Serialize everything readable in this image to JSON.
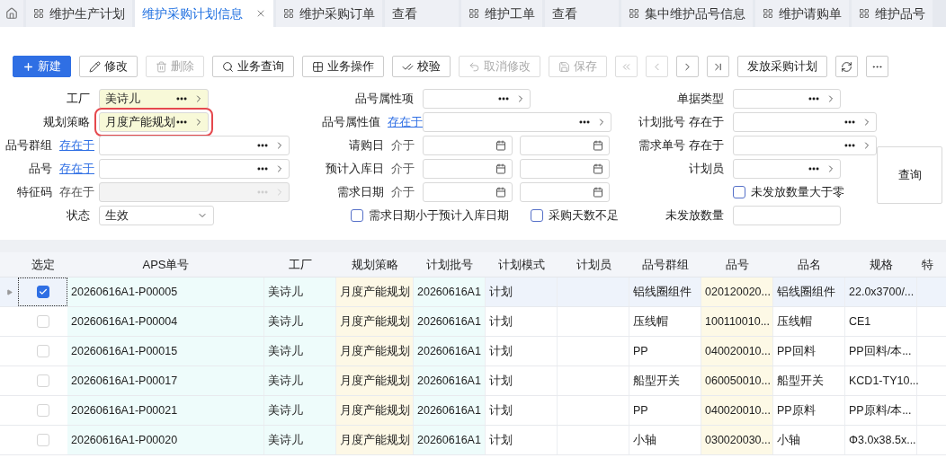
{
  "tabs": [
    {
      "label": "维护生产计划",
      "kind": "page",
      "selected": false
    },
    {
      "label": "维护采购计划信息",
      "kind": "closable",
      "selected": true
    },
    {
      "label": "维护采购订单",
      "kind": "page",
      "selected": false
    },
    {
      "label": "查看",
      "kind": "view",
      "selected": false
    },
    {
      "label": "维护工单",
      "kind": "page",
      "selected": false
    },
    {
      "label": "查看",
      "kind": "view",
      "selected": false
    },
    {
      "label": "集中维护品号信息",
      "kind": "page",
      "selected": false
    },
    {
      "label": "维护请购单",
      "kind": "page",
      "selected": false
    },
    {
      "label": "维护品号",
      "kind": "page",
      "selected": false
    }
  ],
  "toolbar": [
    {
      "kind": "primary",
      "label": "新建",
      "disabled": false
    },
    {
      "kind": "normal",
      "label": "修改",
      "disabled": false
    },
    {
      "kind": "normal",
      "label": "删除",
      "disabled": true
    },
    {
      "kind": "normal",
      "label": "业务查询",
      "disabled": false
    },
    {
      "kind": "normal",
      "label": "业务操作",
      "disabled": false
    },
    {
      "kind": "normal",
      "label": "校验",
      "disabled": false
    },
    {
      "kind": "normal",
      "label": "取消修改",
      "disabled": true
    },
    {
      "kind": "normal",
      "label": "保存",
      "disabled": true
    },
    {
      "kind": "nav",
      "disabled": true
    },
    {
      "kind": "nav",
      "disabled": true
    },
    {
      "kind": "nav",
      "disabled": false
    },
    {
      "kind": "nav",
      "disabled": false
    },
    {
      "kind": "normal",
      "label": "发放采购计划",
      "disabled": false
    },
    {
      "kind": "icon",
      "disabled": false
    },
    {
      "kind": "icon",
      "disabled": false
    }
  ],
  "filters": {
    "left": [
      {
        "kind": "lookup",
        "label": "工厂",
        "value": "美诗儿",
        "tinted": true,
        "highlighted": false,
        "disabled": false
      },
      {
        "kind": "lookup",
        "label": "规划策略",
        "value": "月度产能规划",
        "tinted": true,
        "highlighted": true,
        "disabled": false
      },
      {
        "kind": "lookup_wide",
        "label": "品号群组",
        "operator": "存在于",
        "operator_link": true,
        "tinted": false,
        "highlighted": false,
        "disabled": false
      },
      {
        "kind": "lookup_wide",
        "label": "品号",
        "operator": "存在于",
        "operator_link": true,
        "tinted": false,
        "highlighted": false,
        "disabled": false
      },
      {
        "kind": "lookup_wide",
        "label": "特征码",
        "operator": "存在于",
        "operator_link": false,
        "tinted": false,
        "highlighted": false,
        "disabled": true
      },
      {
        "kind": "select",
        "label": "状态",
        "value": "生效"
      }
    ],
    "middle": [
      {
        "kind": "lookup",
        "label": "品号属性项",
        "tinted": false,
        "highlighted": false,
        "disabled": false
      },
      {
        "kind": "lookup_wide",
        "label": "品号属性值",
        "operator": "存在于",
        "operator_link": true,
        "tinted": false,
        "highlighted": false,
        "disabled": false
      },
      {
        "kind": "date_range",
        "label": "请购日",
        "operator": "介于"
      },
      {
        "kind": "date_range",
        "label": "预计入库日",
        "operator": "介于"
      },
      {
        "kind": "date_range",
        "label": "需求日期",
        "operator": "介于"
      },
      {
        "kind": "checkboxes",
        "items": [
          {
            "label": "需求日期小于预计入库日期",
            "checked": false
          },
          {
            "label": "采购天数不足",
            "checked": false
          }
        ]
      }
    ],
    "right": [
      {
        "kind": "lookup",
        "label": "单据类型",
        "tinted": false,
        "highlighted": false,
        "disabled": false
      },
      {
        "kind": "lookup_wide",
        "label": "计划批号 存在于",
        "tinted": false,
        "highlighted": false,
        "disabled": false
      },
      {
        "kind": "lookup_wide",
        "label": "需求单号 存在于",
        "tinted": false,
        "highlighted": false,
        "disabled": false
      },
      {
        "kind": "lookup",
        "label": "计划员",
        "tinted": false,
        "highlighted": false,
        "disabled": false
      },
      {
        "kind": "checkbox",
        "label": "未发放数量大于零",
        "checked": false
      },
      {
        "kind": "text",
        "label": "未发放数量"
      }
    ],
    "query_button": "查询"
  },
  "table": {
    "columns": [
      {
        "label": "选定"
      },
      {
        "label": "APS单号",
        "color": "#eefcfb"
      },
      {
        "label": "工厂",
        "color": "#eefcfb"
      },
      {
        "label": "规划策略",
        "color": "#fdf8e6"
      },
      {
        "label": "计划批号",
        "color": "#eefcfb"
      },
      {
        "label": "计划模式"
      },
      {
        "label": "计划员"
      },
      {
        "label": "品号群组"
      },
      {
        "label": "品号",
        "color": "#fdf9e6"
      },
      {
        "label": "品名"
      },
      {
        "label": "规格"
      },
      {
        "label": "特"
      }
    ],
    "rows": [
      {
        "current": true,
        "checked": true,
        "cells": [
          "",
          "20260616A1-P00005",
          "美诗儿",
          "月度产能规划",
          "20260616A1",
          "计划",
          "",
          "铝线圈组件",
          "020120020...",
          "铝线圈组件",
          "22.0x3700/...",
          ""
        ]
      },
      {
        "current": false,
        "checked": false,
        "cells": [
          "",
          "20260616A1-P00004",
          "美诗儿",
          "月度产能规划",
          "20260616A1",
          "计划",
          "",
          "压线帽",
          "100110010...",
          "压线帽",
          "CE1",
          ""
        ]
      },
      {
        "current": false,
        "checked": false,
        "cells": [
          "",
          "20260616A1-P00015",
          "美诗儿",
          "月度产能规划",
          "20260616A1",
          "计划",
          "",
          "PP",
          "040020010...",
          "PP回料",
          "PP回料/本...",
          ""
        ]
      },
      {
        "current": false,
        "checked": false,
        "cells": [
          "",
          "20260616A1-P00017",
          "美诗儿",
          "月度产能规划",
          "20260616A1",
          "计划",
          "",
          "船型开关",
          "060050010...",
          "船型开关",
          "KCD1-TY10...",
          ""
        ]
      },
      {
        "current": false,
        "checked": false,
        "cells": [
          "",
          "20260616A1-P00021",
          "美诗儿",
          "月度产能规划",
          "20260616A1",
          "计划",
          "",
          "PP",
          "040020010...",
          "PP原料",
          "PP原料/本...",
          ""
        ]
      },
      {
        "current": false,
        "checked": false,
        "cells": [
          "",
          "20260616A1-P00020",
          "美诗儿",
          "月度产能规划",
          "20260616A1",
          "计划",
          "",
          "小轴",
          "030020030...",
          "小轴",
          "Φ3.0x38.5x...",
          ""
        ]
      }
    ]
  }
}
